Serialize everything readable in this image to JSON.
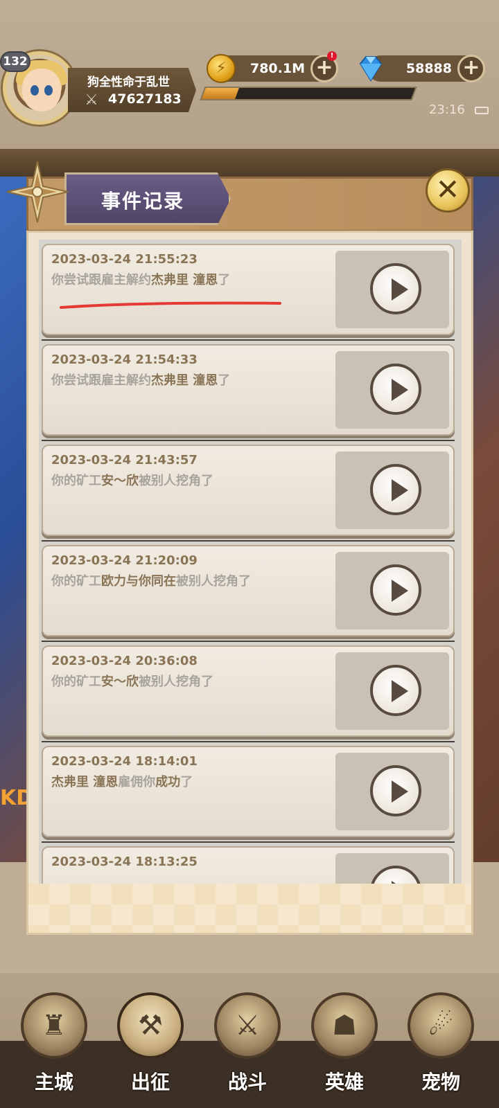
{
  "player": {
    "level": "132",
    "name": "狗全性命于乱世",
    "id": "47627183"
  },
  "currency": {
    "gold": "780.1M",
    "gold_notify": "!",
    "gems": "58888",
    "plus_label": "+"
  },
  "exp_progress": 0.16,
  "status": {
    "clock": "23:16"
  },
  "background": {
    "kd_text": "KD"
  },
  "modal": {
    "title": "事件记录",
    "close_label": "✕",
    "events": [
      {
        "time": "2023-03-24 21:55:23",
        "parts": [
          "你尝试跟雇主解约",
          "杰弗里 潼恩",
          "了"
        ]
      },
      {
        "time": "2023-03-24 21:54:33",
        "parts": [
          "你尝试跟雇主解约",
          "杰弗里 潼恩",
          "了"
        ]
      },
      {
        "time": "2023-03-24 21:43:57",
        "parts": [
          "你的矿工",
          "安～欣",
          "被别人挖角了"
        ]
      },
      {
        "time": "2023-03-24 21:20:09",
        "parts": [
          "你的矿工",
          "欧力与你同在",
          "被别人挖角了"
        ]
      },
      {
        "time": "2023-03-24 20:36:08",
        "parts": [
          "你的矿工",
          "安～欣",
          "被别人挖角了"
        ]
      },
      {
        "time": "2023-03-24 18:14:01",
        "parts": [
          "",
          "杰弗里 潼恩",
          "雇佣你",
          "成功",
          "了"
        ]
      },
      {
        "time": "2023-03-24 18:13:25",
        "parts": []
      }
    ]
  },
  "nav": {
    "items": [
      {
        "label": "主城",
        "icon": "castle-icon"
      },
      {
        "label": "出征",
        "icon": "crossed-axes-icon"
      },
      {
        "label": "战斗",
        "icon": "battle-shield-icon"
      },
      {
        "label": "英雄",
        "icon": "hooded-hero-icon"
      },
      {
        "label": "宠物",
        "icon": "dragon-pet-icon"
      }
    ],
    "active_index": 1
  },
  "colors": {
    "highlight_text": "#8a7456",
    "muted_text": "#a8a39c",
    "annotation_red": "#e53935"
  }
}
